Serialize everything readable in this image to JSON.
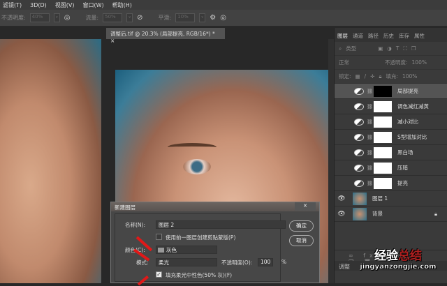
{
  "menu": [
    "滤镜(T)",
    "3D(D)",
    "视图(V)",
    "窗口(W)",
    "帮助(H)"
  ],
  "options": {
    "opacity_label": "不透明度:",
    "opacity": "40%",
    "flow_label": "流量:",
    "flow": "50%",
    "smooth_label": "平滑:",
    "smooth": "10%"
  },
  "doc_tab": "调整后.tif @ 20.3% (局部提亮, RGB/16*) *",
  "panel": {
    "tabs": [
      "图层",
      "通道",
      "路径",
      "历史",
      "库存",
      "属性"
    ],
    "search": "类型",
    "blend": "正常",
    "opacity_label": "不透明度:",
    "opacity": "100%",
    "lock_label": "锁定:",
    "fill_label": "填充:",
    "fill": "100%",
    "layers": [
      {
        "name": "局部提亮",
        "type": "adjust",
        "mask": "black",
        "visible": false,
        "selected": true
      },
      {
        "name": "调色减红减黄",
        "type": "adjust",
        "mask": "white",
        "visible": false
      },
      {
        "name": "减小对比",
        "type": "adjust",
        "mask": "white",
        "visible": false
      },
      {
        "name": "S型增加对比",
        "type": "adjust",
        "mask": "white",
        "visible": false
      },
      {
        "name": "黑白场",
        "type": "adjust",
        "mask": "white",
        "visible": false
      },
      {
        "name": "压暗",
        "type": "adjust",
        "mask": "white",
        "visible": false
      },
      {
        "name": "提亮",
        "type": "adjust",
        "mask": "white",
        "visible": false
      },
      {
        "name": "图层 1",
        "type": "image",
        "visible": true
      },
      {
        "name": "背景",
        "type": "image",
        "visible": true,
        "locked": true
      }
    ],
    "adjust_label": "调整"
  },
  "dialog": {
    "title": "新建图层",
    "name_label": "名称(N):",
    "name_value": "图层 2",
    "clip_label": "使用前一图层创建剪贴蒙版(P)",
    "color_label": "颜色(C):",
    "color_value": "灰色",
    "mode_label": "模式:",
    "mode_value": "柔光",
    "opacity_label": "不透明度(O):",
    "opacity_value": "100",
    "percent": "%",
    "fill_label": "填充柔光中性色(50% 灰)(F)",
    "ok": "确定",
    "cancel": "取消"
  },
  "watermark": {
    "line1a": "经验",
    "line1b": "总结",
    "line2": "jingyanzongjie.com"
  }
}
